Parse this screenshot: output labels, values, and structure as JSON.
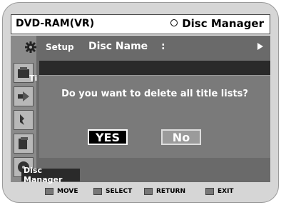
{
  "header": {
    "device": "DVD-RAM(VR)",
    "section": "Disc Manager"
  },
  "menu": {
    "setup_label": "Setup",
    "field_label": "Disc Name",
    "field_sep": ":",
    "partial_label": "Ti"
  },
  "dialog": {
    "question": "Do you want to delete all title lists?",
    "yes_label": "YES",
    "no_label": "No"
  },
  "sidebar": {
    "active_label": "Disc Manager",
    "icons": [
      "title-list-icon",
      "playlist-icon",
      "record-icon",
      "edit-icon",
      "disc-manager-icon"
    ]
  },
  "footer": {
    "hints": [
      "MOVE",
      "SELECT",
      "RETURN",
      "EXIT"
    ],
    "icons": [
      "updown-key-icon",
      "enter-key-icon",
      "return-key-icon",
      "menu-key-icon"
    ]
  },
  "colors": {
    "panel": "#6a6a6a",
    "dialog": "#7a7a7a",
    "selected_button": "#000000"
  }
}
